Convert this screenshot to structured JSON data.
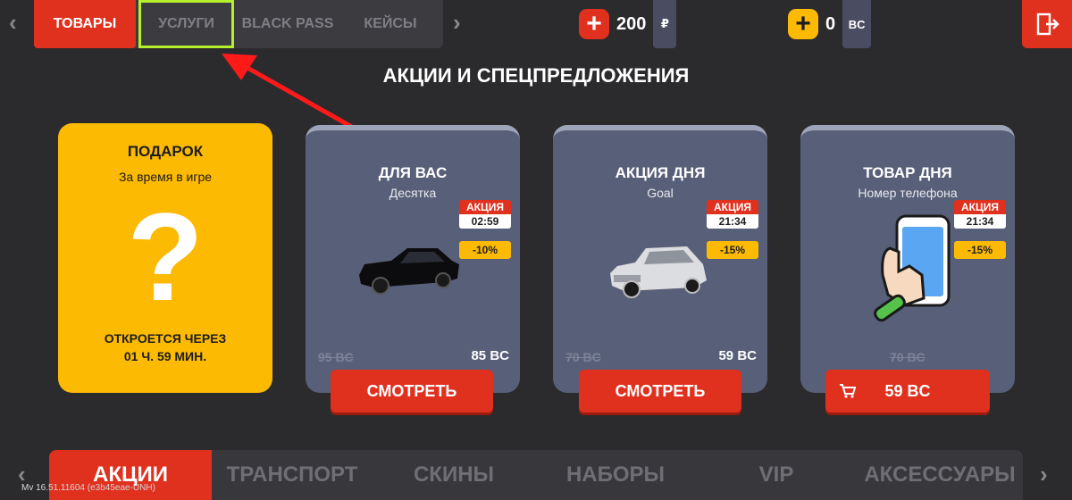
{
  "top_nav": {
    "tabs": [
      {
        "label": "ТОВАРЫ"
      },
      {
        "label": "УСЛУГИ"
      },
      {
        "label": "BLACK PASS"
      },
      {
        "label": "КЕЙСЫ"
      }
    ],
    "prev_glyph": "‹",
    "next_glyph": "›"
  },
  "currencies": [
    {
      "plus": "+",
      "amount": "200",
      "unit": "₽",
      "color": "#e0301e"
    },
    {
      "plus": "+",
      "amount": "0",
      "unit": "BC",
      "color": "#fcba03"
    }
  ],
  "heading": "АКЦИИ И СПЕЦПРЕДЛОЖЕНИЯ",
  "gift": {
    "title": "ПОДАРОК",
    "subtitle": "За время в игре",
    "symbol": "?",
    "opens_line1": "ОТКРОЕТСЯ ЧЕРЕЗ",
    "opens_line2": "01 Ч. 59 МИН."
  },
  "cards": [
    {
      "title": "ДЛЯ ВАС",
      "subtitle": "Десятка",
      "promo_label": "АКЦИЯ",
      "timer": "02:59",
      "discount": "-10%",
      "old_price": "95 BC",
      "new_price": "85 BC",
      "button": "СМОТРЕТЬ",
      "item_icon": "black-sedan-car"
    },
    {
      "title": "АКЦИЯ ДНЯ",
      "subtitle": "Goal",
      "promo_label": "АКЦИЯ",
      "timer": "21:34",
      "discount": "-15%",
      "old_price": "70 BC",
      "new_price": "59 BC",
      "button": "СМОТРЕТЬ",
      "item_icon": "white-hatchback-car"
    },
    {
      "title": "ТОВАР ДНЯ",
      "subtitle": "Номер телефона",
      "promo_label": "АКЦИЯ",
      "timer": "21:34",
      "discount": "-15%",
      "old_price": "70 BC",
      "new_price": "",
      "button": "59 BC",
      "button_icon": "cart-icon",
      "item_icon": "phone-in-hand"
    }
  ],
  "bottom_nav": {
    "tabs": [
      {
        "label": "АКЦИИ"
      },
      {
        "label": "ТРАНСПОРТ"
      },
      {
        "label": "СКИНЫ"
      },
      {
        "label": "НАБОРЫ"
      },
      {
        "label": "VIP"
      },
      {
        "label": "АКСЕССУАРЫ"
      }
    ],
    "prev_glyph": "‹",
    "next_glyph": "›"
  },
  "version": "Mv 16.51.11604 (e3b45eae-UNH)"
}
